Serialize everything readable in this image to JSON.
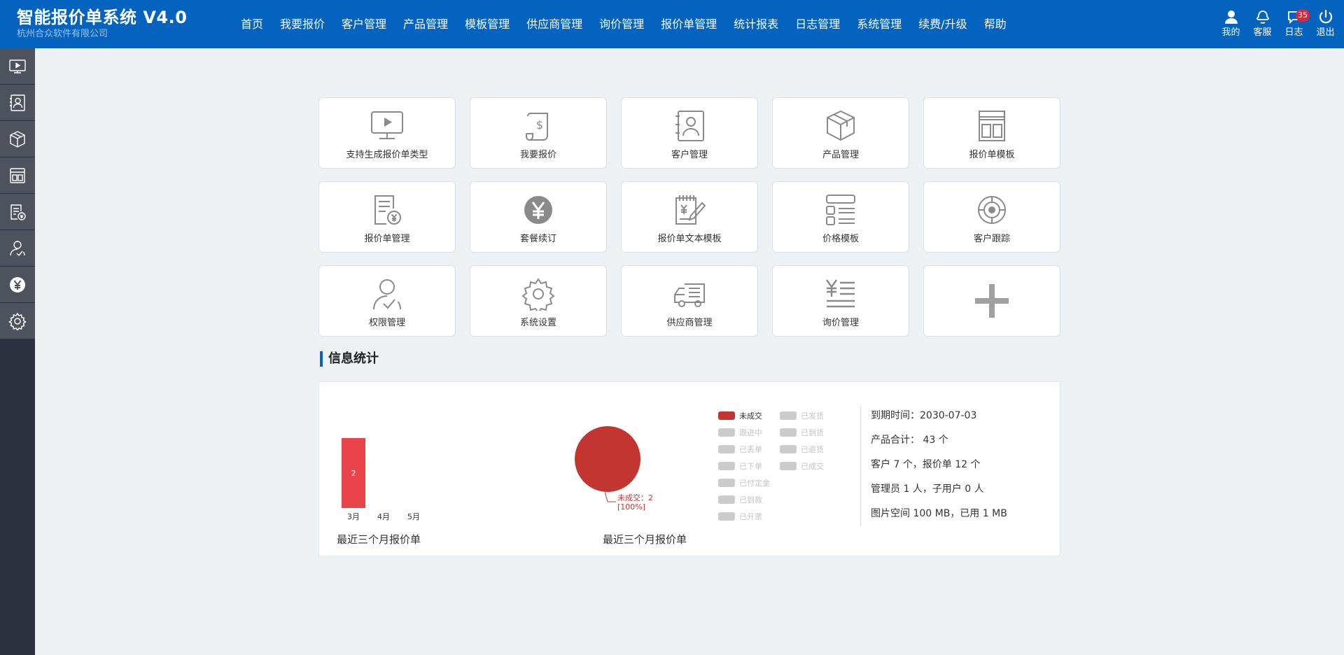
{
  "brand": {
    "title": "智能报价单系统 V4.0",
    "subtitle": "杭州合众软件有限公司"
  },
  "nav": [
    {
      "label": "首页"
    },
    {
      "label": "我要报价"
    },
    {
      "label": "客户管理"
    },
    {
      "label": "产品管理"
    },
    {
      "label": "模板管理"
    },
    {
      "label": "供应商管理"
    },
    {
      "label": "询价管理"
    },
    {
      "label": "报价单管理"
    },
    {
      "label": "统计报表"
    },
    {
      "label": "日志管理"
    },
    {
      "label": "系统管理"
    },
    {
      "label": "续费/升级"
    },
    {
      "label": "帮助"
    }
  ],
  "header_right": [
    {
      "label": "我的",
      "icon": "user-icon"
    },
    {
      "label": "客服",
      "icon": "service-icon"
    },
    {
      "label": "日志",
      "icon": "chat-icon",
      "badge": "35"
    },
    {
      "label": "退出",
      "icon": "power-icon"
    }
  ],
  "sidebar": [
    {
      "icon": "monitor-play-icon"
    },
    {
      "icon": "contact-card-icon"
    },
    {
      "icon": "package-box-icon"
    },
    {
      "icon": "layout-template-icon"
    },
    {
      "icon": "quote-doc-icon"
    },
    {
      "icon": "user-check-icon"
    },
    {
      "icon": "yen-coin-icon"
    },
    {
      "icon": "gear-icon"
    }
  ],
  "tiles": [
    {
      "label": "支持生成报价单类型",
      "icon": "monitor-play-icon"
    },
    {
      "label": "我要报价",
      "icon": "dollar-doc-icon"
    },
    {
      "label": "客户管理",
      "icon": "contact-card-icon"
    },
    {
      "label": "产品管理",
      "icon": "package-box-icon"
    },
    {
      "label": "报价单模板",
      "icon": "layout-template-icon"
    },
    {
      "label": "报价单管理",
      "icon": "quote-doc-icon"
    },
    {
      "label": "套餐续订",
      "icon": "yen-coin-icon"
    },
    {
      "label": "报价单文本模板",
      "icon": "notepad-pen-icon"
    },
    {
      "label": "价格模板",
      "icon": "price-layout-icon"
    },
    {
      "label": "客户跟踪",
      "icon": "target-icon"
    },
    {
      "label": "权限管理",
      "icon": "user-check-icon"
    },
    {
      "label": "系统设置",
      "icon": "gear-icon"
    },
    {
      "label": "供应商管理",
      "icon": "truck-icon"
    },
    {
      "label": "询价管理",
      "icon": "yen-list-icon"
    },
    {
      "label": "",
      "icon": "plus-icon"
    }
  ],
  "stats": {
    "section_title": "信息统计",
    "bar_caption": "最近三个月报价单",
    "pie_caption": "最近三个月报价单",
    "info": [
      "到期时间：2030-07-03",
      "产品合计： 43 个",
      "客户 7 个，报价单 12 个",
      "管理员 1 人，子用户 0 人",
      "图片空间 100 MB，已用 1 MB"
    ]
  },
  "chart_data": [
    {
      "type": "bar",
      "categories": [
        "3月",
        "4月",
        "5月"
      ],
      "values": [
        2,
        0,
        0
      ],
      "ylim": [
        0,
        2
      ],
      "title": "",
      "caption": "最近三个月报价单",
      "color": "#e8444a",
      "data_labels": true
    },
    {
      "type": "pie",
      "slices": [
        {
          "name": "未成交",
          "value": 2,
          "percent": 100,
          "color": "#c23531"
        }
      ],
      "callout": {
        "name": "未成交",
        "value": "2",
        "percent": "[100%]"
      },
      "caption": "最近三个月报价单",
      "legend": {
        "placement": "right",
        "items": [
          {
            "name": "未成交",
            "active": true,
            "color": "#c23531"
          },
          {
            "name": "跟进中",
            "active": false,
            "color": "#cccccc"
          },
          {
            "name": "已丢单",
            "active": false,
            "color": "#cccccc"
          },
          {
            "name": "已下单",
            "active": false,
            "color": "#cccccc"
          },
          {
            "name": "已付定金",
            "active": false,
            "color": "#cccccc"
          },
          {
            "name": "已到款",
            "active": false,
            "color": "#cccccc"
          },
          {
            "name": "已开票",
            "active": false,
            "color": "#cccccc"
          },
          {
            "name": "已发货",
            "active": false,
            "color": "#cccccc"
          },
          {
            "name": "已到货",
            "active": false,
            "color": "#cccccc"
          },
          {
            "name": "已退货",
            "active": false,
            "color": "#cccccc"
          },
          {
            "name": "已成交",
            "active": false,
            "color": "#cccccc"
          }
        ]
      }
    }
  ],
  "colors": {
    "header": "#0563c0",
    "sidebar": "#2d3241",
    "sidebar_item": "#4d525d",
    "bar": "#e8444a",
    "pie": "#c23531",
    "badge": "#d9263a"
  }
}
